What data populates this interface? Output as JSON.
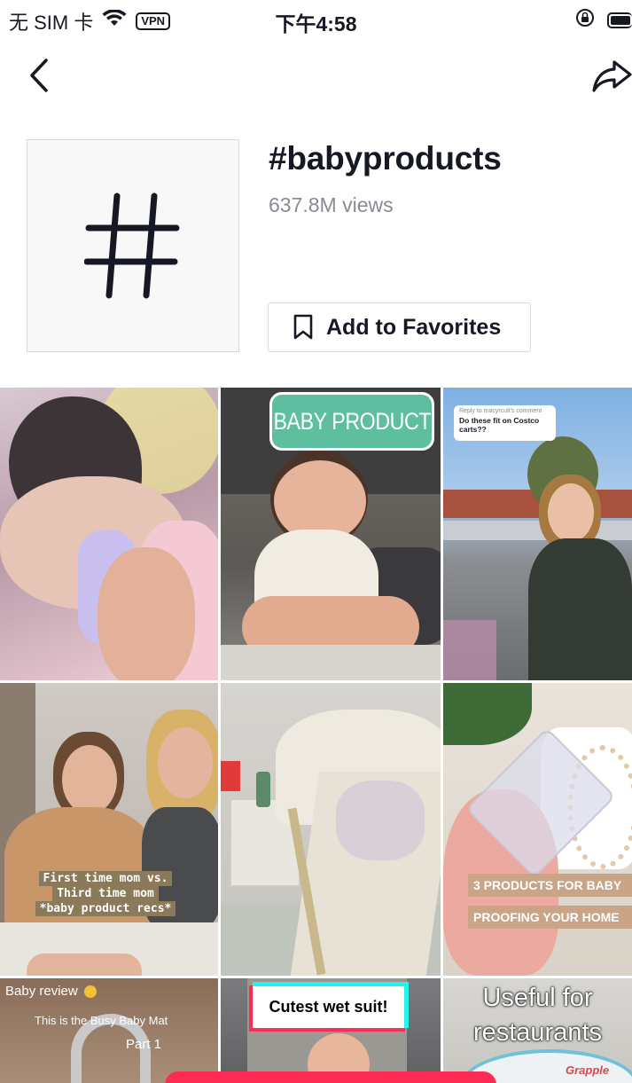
{
  "status_bar": {
    "carrier": "无 SIM 卡",
    "vpn": "VPN",
    "time": "下午4:58"
  },
  "hashtag": {
    "title": "#babyproducts",
    "views": "637.8M views",
    "favorite_label": "Add to Favorites"
  },
  "videos": [
    {
      "overlay": ""
    },
    {
      "overlay": "BABY PRODUCT"
    },
    {
      "overlay": "Do these fit on Costco carts??",
      "caption": "Reply to macyrcult's comment"
    },
    {
      "overlay_lines": [
        "First time mom vs.",
        "Third time mom",
        "*baby product recs*"
      ]
    },
    {
      "overlay": ""
    },
    {
      "overlay_lines": [
        "3 PRODUCTS FOR BABY",
        "PROOFING YOUR HOME"
      ]
    },
    {
      "overlay_lines": [
        "Baby review",
        "This is the Busy Baby Mat",
        "Part 1"
      ]
    },
    {
      "overlay": "Cutest wet suit!"
    },
    {
      "overlay_lines": [
        "Useful for",
        "restaurants"
      ],
      "brand": "Grapple"
    }
  ],
  "colors": {
    "accent": "#fe2c55",
    "teal_label": "#5dbf9f",
    "text": "#161823",
    "muted": "#8a8b91"
  }
}
